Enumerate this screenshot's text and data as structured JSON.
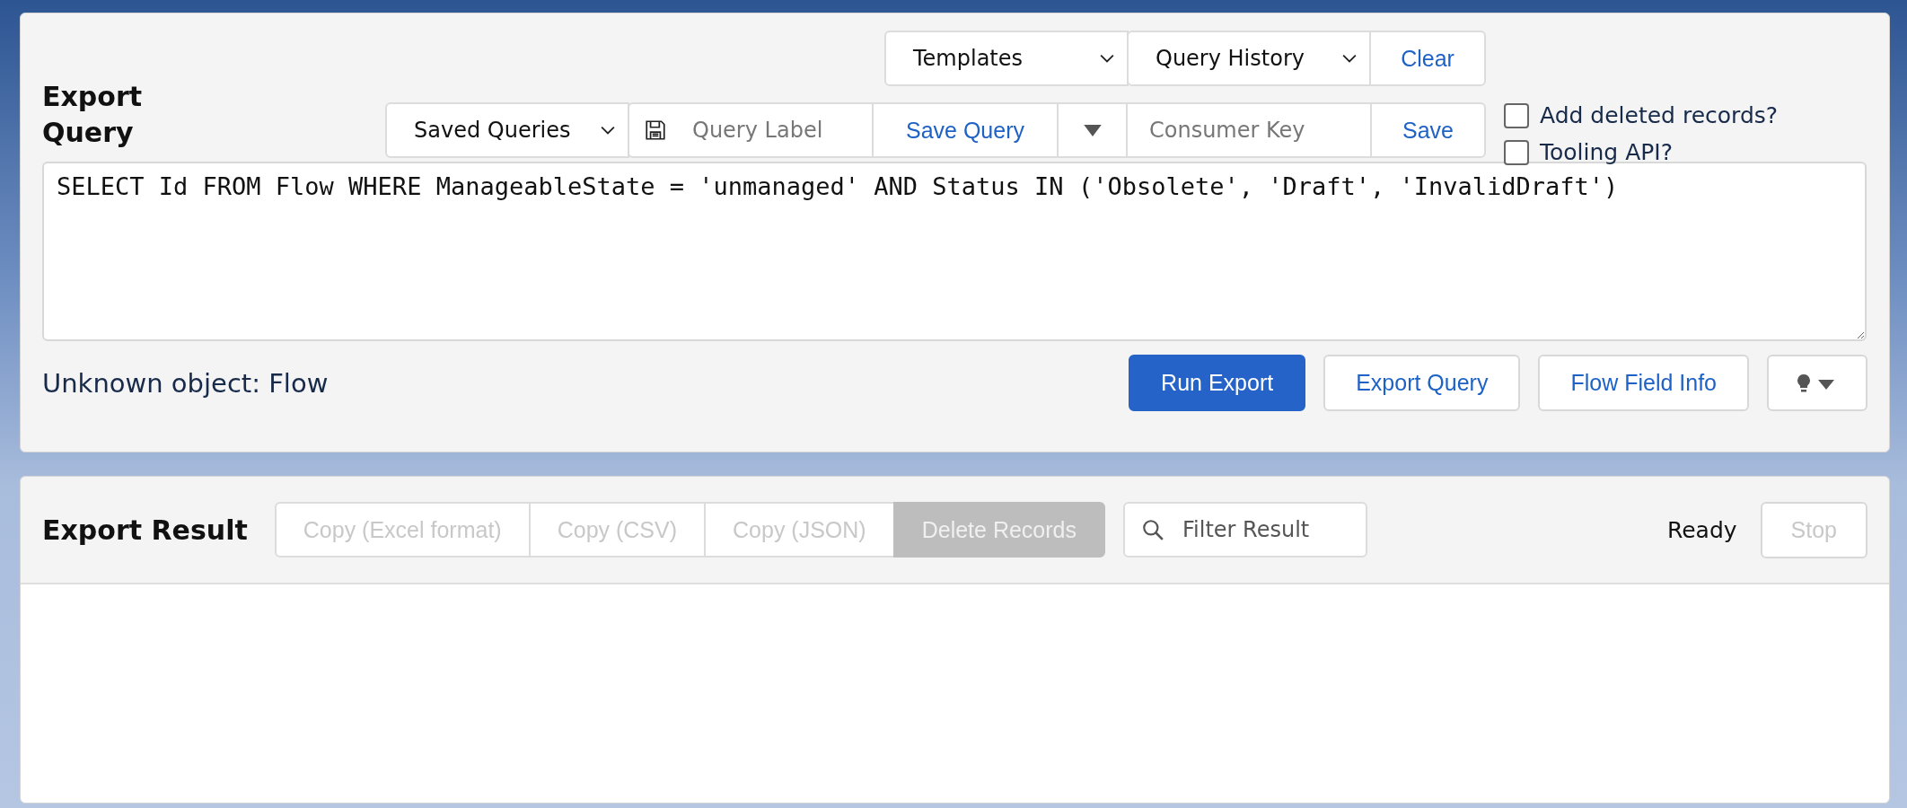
{
  "query_panel": {
    "title": "Export Query",
    "templates": {
      "label": "Templates"
    },
    "query_history": {
      "label": "Query History"
    },
    "clear_button": "Clear",
    "saved_queries": {
      "label": "Saved Queries"
    },
    "query_label": {
      "placeholder": "Query Label"
    },
    "save_query_button": "Save Query",
    "consumer_key": {
      "placeholder": "Consumer Key"
    },
    "save_button": "Save",
    "options": [
      {
        "label": "Add deleted records?",
        "checked": false
      },
      {
        "label": "Tooling API?",
        "checked": false
      }
    ],
    "query": "SELECT Id FROM Flow WHERE ManageableState = 'unmanaged' AND Status IN ('Obsolete', 'Draft', 'InvalidDraft')",
    "status": "Unknown object: Flow",
    "actions": [
      {
        "label": "Run Export",
        "kind": "primary"
      },
      {
        "label": "Export Query",
        "kind": "secondary"
      },
      {
        "label": "Flow Field Info",
        "kind": "secondary"
      }
    ]
  },
  "result_panel": {
    "title": "Export Result",
    "copy_buttons": [
      {
        "label": "Copy (Excel format)",
        "disabled": true,
        "kind": "copy"
      },
      {
        "label": "Copy (CSV)",
        "disabled": true,
        "kind": "copy"
      },
      {
        "label": "Copy (JSON)",
        "disabled": true,
        "kind": "copy"
      },
      {
        "label": "Delete Records",
        "disabled": true,
        "kind": "delete"
      }
    ],
    "filter": {
      "placeholder": "Filter Result"
    },
    "state": "Ready",
    "stop_button": {
      "label": "Stop",
      "disabled": true
    }
  }
}
